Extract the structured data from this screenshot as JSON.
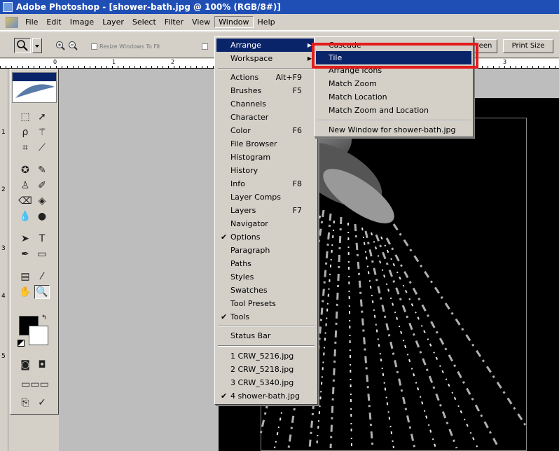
{
  "window": {
    "title": "Adobe Photoshop - [shower-bath.jpg @ 100% (RGB/8#)]"
  },
  "menubar": {
    "items": [
      "File",
      "Edit",
      "Image",
      "Layer",
      "Select",
      "Filter",
      "View",
      "Window",
      "Help"
    ],
    "active": "Window"
  },
  "optionsbar": {
    "resize_windows_label": "Resize Windows To Fit",
    "screen_button_label": "een",
    "print_size_label": "Print Size"
  },
  "rulers": {
    "top": [
      "0",
      "1",
      "2",
      "3"
    ],
    "left": [
      "1",
      "2",
      "3",
      "4",
      "5"
    ]
  },
  "window_menu": {
    "arrange": "Arrange",
    "workspace": "Workspace",
    "palettes": [
      {
        "label": "Actions",
        "shortcut": "Alt+F9",
        "checked": false
      },
      {
        "label": "Brushes",
        "shortcut": "F5",
        "checked": false
      },
      {
        "label": "Channels",
        "shortcut": "",
        "checked": false
      },
      {
        "label": "Character",
        "shortcut": "",
        "checked": false
      },
      {
        "label": "Color",
        "shortcut": "F6",
        "checked": false
      },
      {
        "label": "File Browser",
        "shortcut": "",
        "checked": false
      },
      {
        "label": "Histogram",
        "shortcut": "",
        "checked": false
      },
      {
        "label": "History",
        "shortcut": "",
        "checked": false
      },
      {
        "label": "Info",
        "shortcut": "F8",
        "checked": false
      },
      {
        "label": "Layer Comps",
        "shortcut": "",
        "checked": false
      },
      {
        "label": "Layers",
        "shortcut": "F7",
        "checked": false
      },
      {
        "label": "Navigator",
        "shortcut": "",
        "checked": false
      },
      {
        "label": "Options",
        "shortcut": "",
        "checked": true
      },
      {
        "label": "Paragraph",
        "shortcut": "",
        "checked": false
      },
      {
        "label": "Paths",
        "shortcut": "",
        "checked": false
      },
      {
        "label": "Styles",
        "shortcut": "",
        "checked": false
      },
      {
        "label": "Swatches",
        "shortcut": "",
        "checked": false
      },
      {
        "label": "Tool Presets",
        "shortcut": "",
        "checked": false
      },
      {
        "label": "Tools",
        "shortcut": "",
        "checked": true
      }
    ],
    "status_bar": "Status Bar",
    "documents": [
      {
        "label": "1 CRW_5216.jpg",
        "checked": false
      },
      {
        "label": "2 CRW_5218.jpg",
        "checked": false
      },
      {
        "label": "3 CRW_5340.jpg",
        "checked": false
      },
      {
        "label": "4 shower-bath.jpg",
        "checked": true
      }
    ]
  },
  "arrange_submenu": {
    "items": [
      "Cascade",
      "Tile",
      "Arrange Icons",
      "Match Zoom",
      "Match Location",
      "Match Zoom and Location"
    ],
    "new_window": "New Window for shower-bath.jpg",
    "highlighted": "Tile"
  },
  "colors": {
    "titlebar": "#1f4fb5",
    "menu_highlight": "#0a246a",
    "annotation": "#e31b1b",
    "chrome": "#d4d0c8"
  }
}
